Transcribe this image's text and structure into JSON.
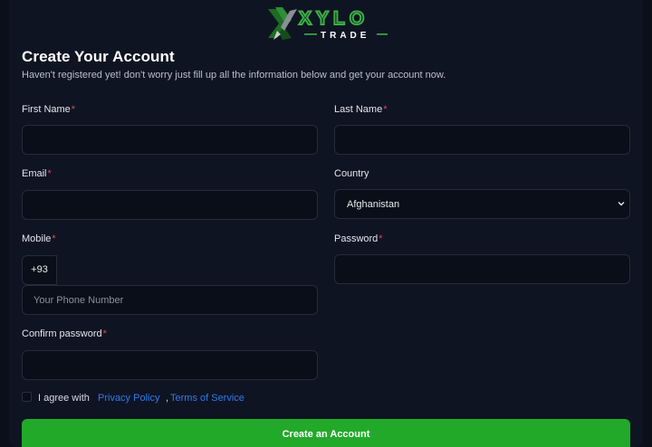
{
  "brand": {
    "name": "XYLO",
    "tagline": "TRADE"
  },
  "page": {
    "title": "Create Your Account",
    "subtitle": "Haven't registered yet! don't worry just fill up all the information below and get your account now."
  },
  "form": {
    "first_name": {
      "label": "First Name",
      "value": ""
    },
    "last_name": {
      "label": "Last Name",
      "value": ""
    },
    "email": {
      "label": "Email",
      "value": ""
    },
    "country": {
      "label": "Country",
      "selected": "Afghanistan"
    },
    "mobile": {
      "label": "Mobile",
      "prefix": "+93",
      "placeholder": "Your Phone Number",
      "value": ""
    },
    "password": {
      "label": "Password",
      "value": ""
    },
    "confirm_password": {
      "label": "Confirm password",
      "value": ""
    },
    "required_mark": "*",
    "agree": {
      "text": "I agree with",
      "privacy_link": "Privacy Policy",
      "separator": ",",
      "terms_link": "Terms of Service"
    },
    "submit_label": "Create an Account"
  },
  "colors": {
    "accent_green": "#22a92a",
    "link_blue": "#2e7bf0",
    "required_red": "#e0445a",
    "background": "#0f1422"
  }
}
